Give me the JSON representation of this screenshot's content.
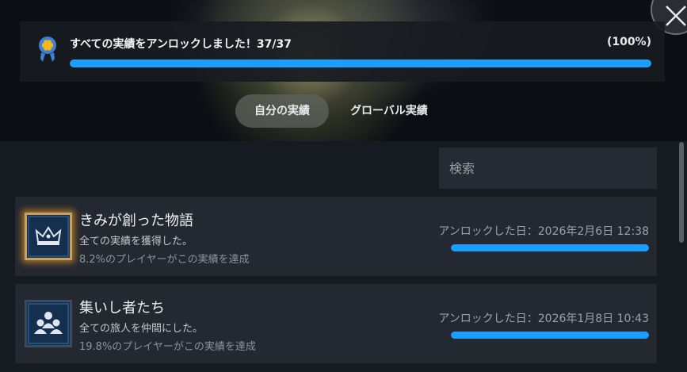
{
  "window": {
    "close_icon": "close-icon"
  },
  "progress": {
    "medal_icon": "medal-icon",
    "title": "すべての実績をアンロックしました！37/37",
    "percent_label": "(100%)",
    "fraction": 1.0
  },
  "tabs": [
    {
      "label": "自分の実績",
      "active": true
    },
    {
      "label": "グローバル実績",
      "active": false
    }
  ],
  "search": {
    "placeholder": "検索"
  },
  "achievements": [
    {
      "icon": "crown-icon",
      "name": "きみが創った物語",
      "description": "全ての実績を獲得した。",
      "rate": "8.2%のプレイヤーがこの実績を達成",
      "unlock_date": "アンロックした日：2026年2月6日 12:38",
      "progress_fraction": 1.0
    },
    {
      "icon": "people-icon",
      "name": "集いし者たち",
      "description": "全ての旅人を仲間にした。",
      "rate": "19.8%のプレイヤーがこの実績を達成",
      "unlock_date": "アンロックした日：2026年1月8日 10:43",
      "progress_fraction": 1.0
    }
  ],
  "colors": {
    "accent": "#1a9fff",
    "row_bg": "#242830",
    "medal_gold": "#f5b818",
    "medal_blue": "#3b7fd6"
  }
}
